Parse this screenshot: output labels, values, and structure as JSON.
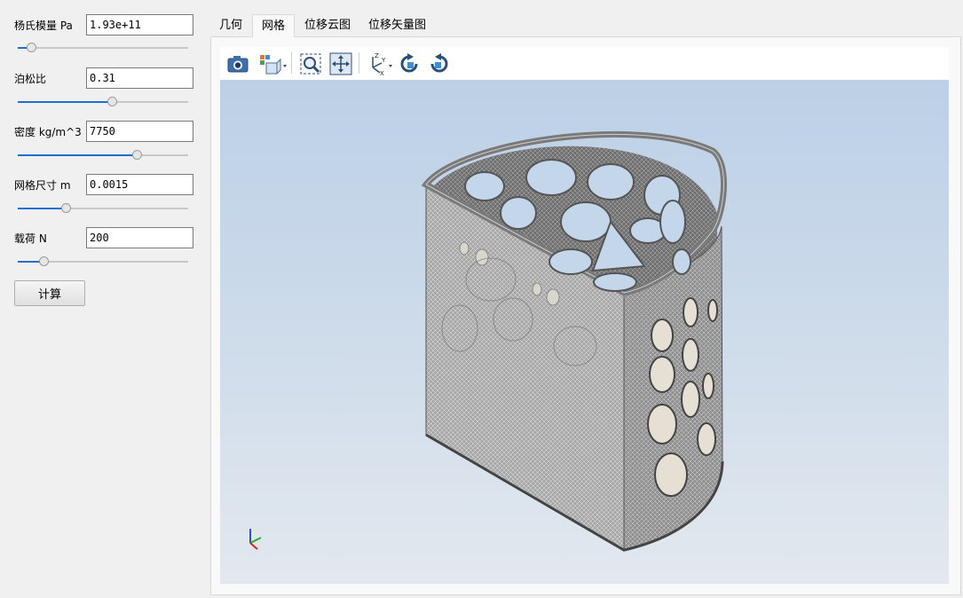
{
  "params": [
    {
      "label": "杨氏模量 Pa",
      "value": "1.93e+11",
      "slider": 0.08
    },
    {
      "label": "泊松比",
      "value": "0.31",
      "slider": 0.55
    },
    {
      "label": "密度 kg/m^3",
      "value": "7750",
      "slider": 0.7
    },
    {
      "label": "网格尺寸 m",
      "value": "0.0015",
      "slider": 0.28
    },
    {
      "label": "载荷 N",
      "value": "200",
      "slider": 0.15
    }
  ],
  "calc_button_label": "计算",
  "tabs": [
    {
      "label": "几何",
      "active": false
    },
    {
      "label": "网格",
      "active": true
    },
    {
      "label": "位移云图",
      "active": false
    },
    {
      "label": "位移矢量图",
      "active": false
    }
  ],
  "toolbar": [
    {
      "icon": "camera-icon"
    },
    {
      "icon": "view-style-icon"
    },
    {
      "icon": "zoom-box-icon"
    },
    {
      "icon": "fit-all-icon"
    },
    {
      "icon": "axes-orientation-icon"
    },
    {
      "icon": "rotate-cw-icon"
    },
    {
      "icon": "rotate-ccw-icon"
    }
  ],
  "colors": {
    "accent": "#1f6fd1",
    "viewport_top": "#bcd0e6",
    "viewport_bottom": "#e3e8ee",
    "mesh_body": "#8f8f8f",
    "mesh_lines": "#d6d6d6"
  }
}
